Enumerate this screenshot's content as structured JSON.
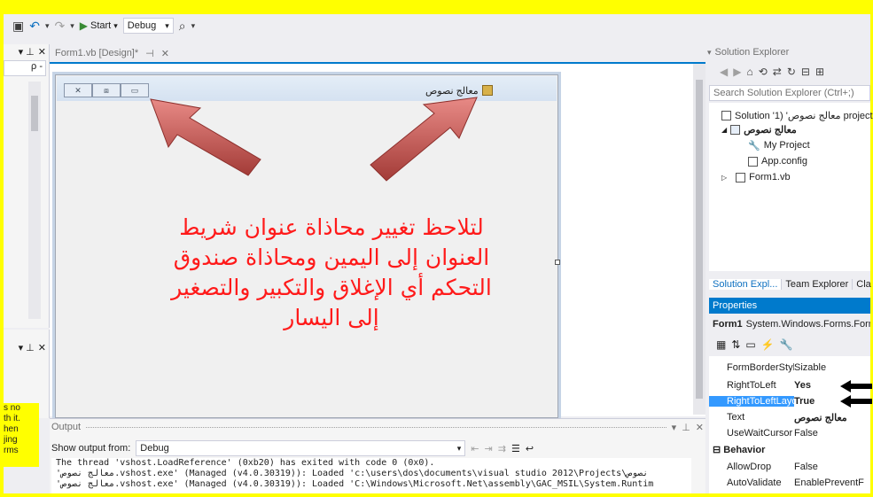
{
  "toolbar": {
    "start_label": "Start",
    "config_value": "Debug"
  },
  "left_panel": {
    "search_placeholder": "ρ -",
    "cut_text": [
      "s no",
      "th it.",
      "hen",
      "jing",
      "rms"
    ]
  },
  "doc_tab": {
    "label": "Form1.vb [Design]*"
  },
  "form": {
    "title": "معالج نصوص",
    "min_glyph": "▭",
    "max_glyph": "⧈",
    "close_glyph": "✕"
  },
  "annotation": {
    "lines": [
      "لتلاحظ تغيير محاذاة عنوان شريط",
      "العنوان إلى اليمين ومحاذاة صندوق",
      "التحكم أي الإغلاق والتكبير والتصغير",
      "إلى اليسار"
    ],
    "color": "#FF1A1A"
  },
  "output": {
    "title": "Output",
    "show_from_label": "Show output from:",
    "show_from_value": "Debug",
    "lines": [
      "The thread 'vshost.LoadReference' (0xb20) has exited with code 0 (0x0).",
      "'معالج نصوص.vshost.exe' (Managed (v4.0.30319)): Loaded 'c:\\users\\dos\\documents\\visual studio 2012\\Projects\\نصوص",
      "'معالج نصوص.vshost.exe' (Managed (v4.0.30319)): Loaded 'C:\\Windows\\Microsoft.Net\\assembly\\GAC_MSIL\\System.Runtim"
    ]
  },
  "solution_explorer": {
    "title": "Solution Explorer",
    "search_placeholder": "Search Solution Explorer (Ctrl+;)",
    "tree": {
      "solution": "Solution 'معالج نصوص' (1 project",
      "project": "معالج نصوص",
      "my_project": "My Project",
      "app_config": "App.config",
      "form1": "Form1.vb"
    },
    "tabs": [
      "Solution Expl...",
      "Team Explorer",
      "Cla"
    ]
  },
  "properties": {
    "title": "Properties",
    "object_name": "Form1",
    "object_type": "System.Windows.Forms.Form",
    "rows": [
      {
        "name": "FormBorderStyle",
        "value": "Sizable"
      },
      {
        "name": "RightToLeft",
        "value": "Yes"
      },
      {
        "name": "RightToLeftLayout",
        "value": "True"
      },
      {
        "name": "Text",
        "value": "معالج نصوص"
      },
      {
        "name": "UseWaitCursor",
        "value": "False"
      }
    ],
    "category_behavior": "Behavior",
    "behavior_rows": [
      {
        "name": "AllowDrop",
        "value": "False"
      },
      {
        "name": "AutoValidate",
        "value": "EnablePreventF"
      }
    ]
  },
  "colors": {
    "frame_highlight": "#FFFF00",
    "accent": "#007ACC",
    "arrow": "#C0504D"
  }
}
